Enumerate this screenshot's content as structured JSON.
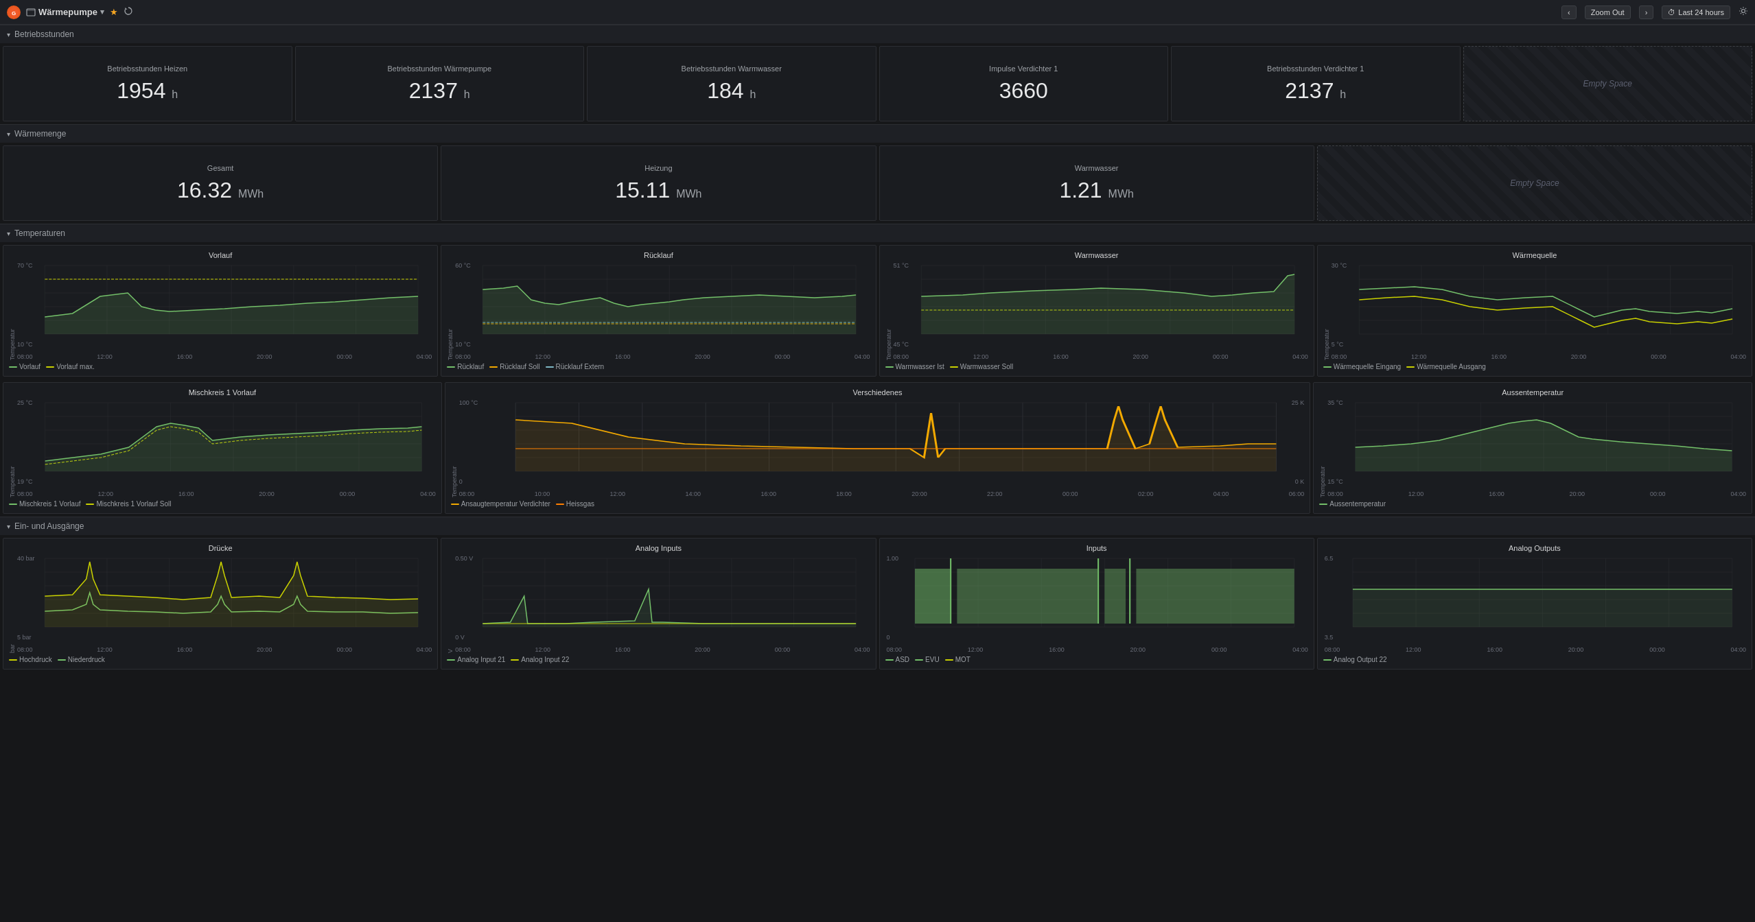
{
  "topbar": {
    "logo": "G",
    "dashboard_name": "Wärmepumpe",
    "chevron_label": "▾",
    "zoom_out": "Zoom Out",
    "time_range": "Last 24 hours",
    "nav_left": "‹",
    "nav_right": "›",
    "clock_icon": "⏱"
  },
  "sections": {
    "betriebsstunden": {
      "label": "Betriebsstunden",
      "stats": [
        {
          "title": "Betriebsstunden Heizen",
          "value": "1954",
          "unit": "h"
        },
        {
          "title": "Betriebsstunden Wärmepumpe",
          "value": "2137",
          "unit": "h"
        },
        {
          "title": "Betriebsstunden Warmwasser",
          "value": "184",
          "unit": "h"
        },
        {
          "title": "Impulse Verdichter 1",
          "value": "3660",
          "unit": ""
        },
        {
          "title": "Betriebsstunden Verdichter 1",
          "value": "2137",
          "unit": "h"
        },
        {
          "title": "Empty Space",
          "value": "",
          "unit": "",
          "empty": true
        }
      ]
    },
    "waermemenge": {
      "label": "Wärmemenge",
      "stats": [
        {
          "title": "Gesamt",
          "value": "16.32",
          "unit": "MWh"
        },
        {
          "title": "Heizung",
          "value": "15.11",
          "unit": "MWh"
        },
        {
          "title": "Warmwasser",
          "value": "1.21",
          "unit": "MWh"
        },
        {
          "title": "Empty Space",
          "value": "",
          "unit": "",
          "empty": true
        }
      ]
    },
    "temperaturen": {
      "label": "Temperaturen",
      "charts": [
        {
          "title": "Vorlauf",
          "y_max": "70 °C",
          "y_min": "10 °C",
          "y_axis": "Temperatur",
          "x_ticks": [
            "08:00",
            "12:00",
            "16:00",
            "20:00",
            "00:00",
            "04:00"
          ],
          "legend": [
            {
              "label": "Vorlauf",
              "color": "#73bf69"
            },
            {
              "label": "Vorlauf max.",
              "color": "#c8d000"
            }
          ]
        },
        {
          "title": "Rücklauf",
          "y_max": "60 °C",
          "y_min": "10 °C",
          "y_axis": "Temperatur",
          "x_ticks": [
            "08:00",
            "12:00",
            "16:00",
            "20:00",
            "00:00",
            "04:00"
          ],
          "legend": [
            {
              "label": "Rücklauf",
              "color": "#73bf69"
            },
            {
              "label": "Rücklauf Soll",
              "color": "#f2a900"
            },
            {
              "label": "Rücklauf Extern",
              "color": "#7eb7c4"
            }
          ]
        },
        {
          "title": "Warmwasser",
          "y_max": "51 °C",
          "y_min": "45 °C",
          "y_axis": "Temperatur",
          "x_ticks": [
            "08:00",
            "12:00",
            "16:00",
            "20:00",
            "00:00",
            "04:00"
          ],
          "legend": [
            {
              "label": "Warmwasser Ist",
              "color": "#73bf69"
            },
            {
              "label": "Warmwasser Soll",
              "color": "#c8d000"
            }
          ]
        },
        {
          "title": "Wärmequelle",
          "y_max": "30 °C",
          "y_min": "5 °C",
          "y_axis": "Temperatur",
          "x_ticks": [
            "08:00",
            "12:00",
            "16:00",
            "20:00",
            "00:00",
            "04:00"
          ],
          "legend": [
            {
              "label": "Wärmequelle Eingang",
              "color": "#73bf69"
            },
            {
              "label": "Wärmequelle Ausgang",
              "color": "#c8d000"
            }
          ]
        }
      ],
      "charts2": [
        {
          "title": "Mischkreis 1 Vorlauf",
          "y_max": "25 °C",
          "y_min": "19 °C",
          "y_axis": "Temperatur",
          "x_ticks": [
            "08:00",
            "12:00",
            "16:00",
            "20:00",
            "00:00",
            "04:00"
          ],
          "legend": [
            {
              "label": "Mischkreis 1 Vorlauf",
              "color": "#73bf69"
            },
            {
              "label": "Mischkreis 1 Vorlauf Soll",
              "color": "#c8d000"
            }
          ]
        },
        {
          "title": "Verschiedenes",
          "y_max": "100 °C",
          "y_min": "0",
          "y_axis": "Temperatur",
          "y2_max": "25 K",
          "y2_min": "0 K",
          "x_ticks": [
            "08:00",
            "10:00",
            "12:00",
            "14:00",
            "16:00",
            "18:00",
            "20:00",
            "22:00",
            "00:00",
            "02:00",
            "04:00",
            "06:00"
          ],
          "legend": [
            {
              "label": "Ansaugtemperatur Verdichter",
              "color": "#f2a900"
            },
            {
              "label": "Heissgas",
              "color": "#ff7f00"
            }
          ],
          "wide": true
        },
        {
          "title": "Aussentemperatur",
          "y_max": "35 °C",
          "y_min": "15 °C",
          "y_axis": "Temperatur",
          "x_ticks": [
            "08:00",
            "12:00",
            "16:00",
            "20:00",
            "00:00",
            "04:00"
          ],
          "legend": [
            {
              "label": "Aussentemperatur",
              "color": "#73bf69"
            }
          ]
        }
      ]
    },
    "einausgaenge": {
      "label": "Ein- und Ausgänge",
      "charts": [
        {
          "title": "Drücke",
          "y_max": "40 bar",
          "y_min": "5 bar",
          "y_axis": "bar",
          "x_ticks": [
            "08:00",
            "12:00",
            "16:00",
            "20:00",
            "00:00",
            "04:00"
          ],
          "legend": [
            {
              "label": "Hochdruck",
              "color": "#c8d000"
            },
            {
              "label": "Niederdruck",
              "color": "#73bf69"
            }
          ]
        },
        {
          "title": "Analog Inputs",
          "y_max": "0.50 V",
          "y_min": "0 V",
          "y_axis": "V",
          "x_ticks": [
            "08:00",
            "12:00",
            "16:00",
            "20:00",
            "00:00",
            "04:00"
          ],
          "legend": [
            {
              "label": "Analog Input 21",
              "color": "#73bf69"
            },
            {
              "label": "Analog Input 22",
              "color": "#c8d000"
            }
          ]
        },
        {
          "title": "Inputs",
          "y_max": "1.00",
          "y_min": "0",
          "y_axis": "",
          "x_ticks": [
            "08:00",
            "12:00",
            "16:00",
            "20:00",
            "00:00",
            "04:00"
          ],
          "legend": [
            {
              "label": "ASD",
              "color": "#73bf69"
            },
            {
              "label": "EVU",
              "color": "#73bf69"
            },
            {
              "label": "MOT",
              "color": "#c8d000"
            }
          ]
        },
        {
          "title": "Analog Outputs",
          "y_max": "6.5",
          "y_min": "3.5",
          "y_axis": "",
          "x_ticks": [
            "08:00",
            "12:00",
            "16:00",
            "20:00",
            "00:00",
            "04:00"
          ],
          "legend": [
            {
              "label": "Analog Output 22",
              "color": "#73bf69"
            }
          ]
        }
      ]
    }
  }
}
